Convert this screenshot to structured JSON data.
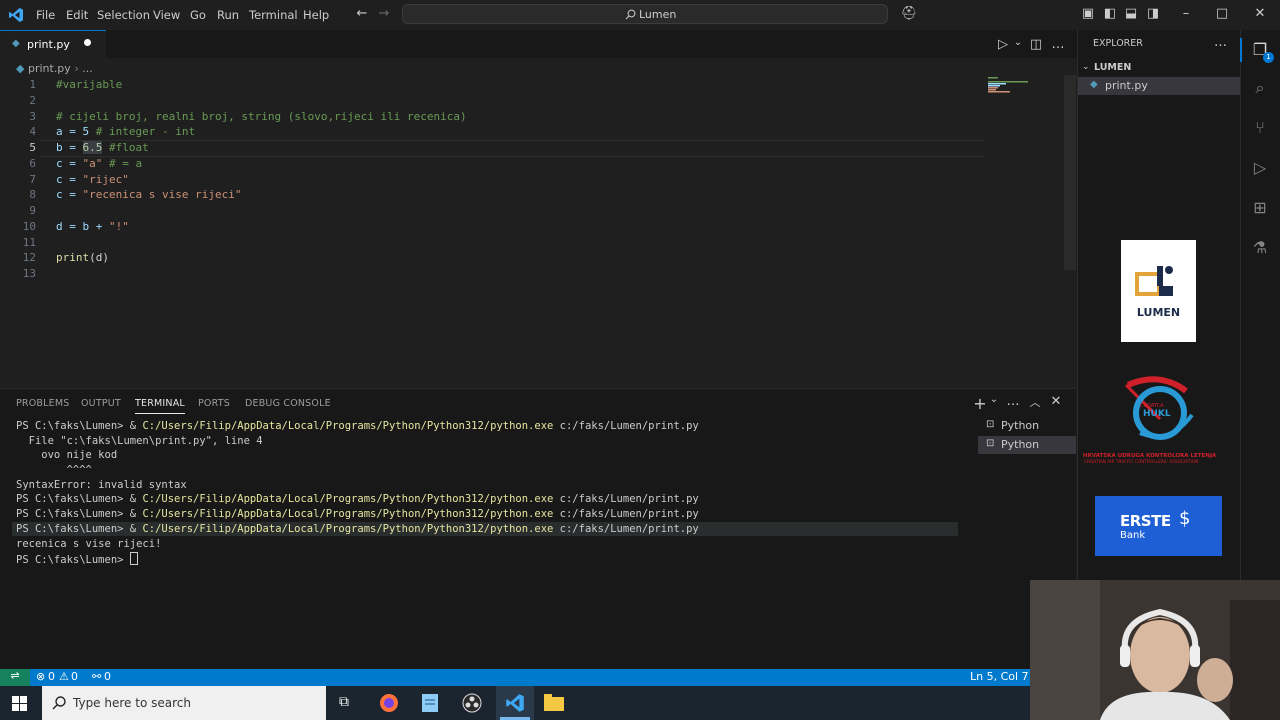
{
  "menu": [
    "File",
    "Edit",
    "Selection",
    "View",
    "Go",
    "Run",
    "Terminal",
    "Help"
  ],
  "search": {
    "text": "Lumen"
  },
  "tab": {
    "label": "print.py"
  },
  "breadcrumb": {
    "file": "print.py",
    "more": "..."
  },
  "code": {
    "line_numbers": [
      "1",
      "2",
      "3",
      "4",
      "5",
      "6",
      "7",
      "8",
      "9",
      "10",
      "11",
      "12",
      "13"
    ],
    "l1": "#varijable",
    "l3": "# cijeli broj, realni broj, string (slovo,rijeci ili recenica)",
    "l4a": "a = 5 ",
    "l4b": "# integer - int",
    "l5a": "b = ",
    "l5b": "6.5",
    "l5c": " #float",
    "l6a": "c = ",
    "l6b": "\"a\"",
    "l6c": " # = a",
    "l7a": "c = ",
    "l7b": "\"rijec\"",
    "l8a": "c = ",
    "l8b": "\"recenica s vise rijeci\"",
    "l10a": "d = b + ",
    "l10b": "\"!\"",
    "l12a": "print",
    "l12b": "(d)"
  },
  "panel": {
    "tabs": [
      "PROBLEMS",
      "OUTPUT",
      "TERMINAL",
      "PORTS",
      "DEBUG CONSOLE"
    ],
    "terminal": {
      "t1a": "PS C:\\faks\\Lumen> & ",
      "t1b": "C:/Users/Filip/AppData/Local/Programs/Python/Python312/python.exe",
      "t1c": " c:/faks/Lumen/print.py",
      "t2": "  File \"c:\\faks\\Lumen\\print.py\", line 4",
      "t3": "    ovo nije kod",
      "t4": "        ^^^^",
      "t5": "SyntaxError: invalid syntax",
      "t6a": "PS C:\\faks\\Lumen> & ",
      "t6b": "C:/Users/Filip/AppData/Local/Programs/Python/Python312/python.exe",
      "t6c": " c:/faks/Lumen/print.py",
      "t7a": "PS C:\\faks\\Lumen> & ",
      "t7b": "C:/Users/Filip/AppData/Local/Programs/Python/Python312/python.exe",
      "t7c": " c:/faks/Lumen/print.py",
      "t8a": "PS C:\\faks\\Lumen> & ",
      "t8b": "C:/Users/Filip/AppData/Local/Programs/Python/Python312/python.exe",
      "t8c": " c:/faks/Lumen/print.py",
      "t9": "recenica s vise rijeci!",
      "t10": "PS C:\\faks\\Lumen> "
    },
    "instances": [
      "Python",
      "Python"
    ]
  },
  "explorer": {
    "title": "EXPLORER",
    "folder": "LUMEN",
    "file": "print.py",
    "badge": "1"
  },
  "sponsors": {
    "lumen": "LUMEN",
    "croatca_name": "HRVATSKA UDRUGA KONTROLORA LETENJA",
    "croatca_en": "CROATIAN AIR TRAFFIC CONTROLLERS' ASSOCIATION",
    "croatca_logo_text": "HUKL",
    "croatca_small": "CROATCA",
    "erste": "ERSTE",
    "erste_sub": "Bank"
  },
  "statusbar": {
    "errors": "0",
    "warnings": "0",
    "ports": "0",
    "position": "Ln 5, Col 7"
  },
  "taskbar": {
    "search_placeholder": "Type here to search"
  },
  "colors": {
    "accent": "#007acc",
    "string": "#ce9178",
    "comment": "#6a9955",
    "number": "#b5cea8"
  }
}
